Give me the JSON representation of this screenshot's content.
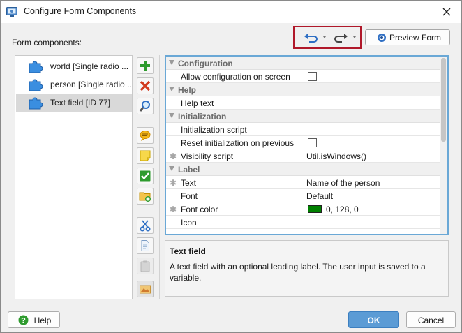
{
  "window": {
    "title": "Configure Form Components"
  },
  "components_label": "Form components:",
  "toolbar": {
    "preview_label": "Preview Form"
  },
  "components": [
    {
      "label": "world [Single radio ...",
      "selected": false
    },
    {
      "label": "person [Single radio ...",
      "selected": false
    },
    {
      "label": "Text field [ID 77]",
      "selected": true
    }
  ],
  "properties": [
    {
      "type": "category",
      "name": "Configuration"
    },
    {
      "type": "prop",
      "name": "Allow configuration on screen",
      "value": "",
      "kind": "checkbox",
      "starred": false
    },
    {
      "type": "category",
      "name": "Help"
    },
    {
      "type": "prop",
      "name": "Help text",
      "value": "",
      "kind": "text",
      "starred": false
    },
    {
      "type": "category",
      "name": "Initialization"
    },
    {
      "type": "prop",
      "name": "Initialization script",
      "value": "",
      "kind": "text",
      "starred": false
    },
    {
      "type": "prop",
      "name": "Reset initialization on previous",
      "value": "",
      "kind": "checkbox",
      "starred": false
    },
    {
      "type": "prop",
      "name": "Visibility script",
      "value": "Util.isWindows()",
      "kind": "text",
      "starred": true
    },
    {
      "type": "category",
      "name": "Label"
    },
    {
      "type": "prop",
      "name": "Text",
      "value": "Name of the person",
      "kind": "text",
      "starred": true
    },
    {
      "type": "prop",
      "name": "Font",
      "value": "Default",
      "kind": "text",
      "starred": false
    },
    {
      "type": "prop",
      "name": "Font color",
      "value": "0, 128, 0",
      "kind": "color",
      "color": "#008000",
      "starred": true
    },
    {
      "type": "prop",
      "name": "Icon",
      "value": "",
      "kind": "text",
      "starred": false
    },
    {
      "type": "prop",
      "name": "",
      "value": "",
      "kind": "text",
      "starred": false
    }
  ],
  "description": {
    "title": "Text field",
    "text": "A text field with an optional leading label. The user input is saved to a variable."
  },
  "buttons": {
    "help": "Help",
    "ok": "OK",
    "cancel": "Cancel"
  },
  "colors": {
    "accent": "#5b9bd5",
    "highlight_box": "#b0182a",
    "selected_row": "#d9d9d9"
  }
}
